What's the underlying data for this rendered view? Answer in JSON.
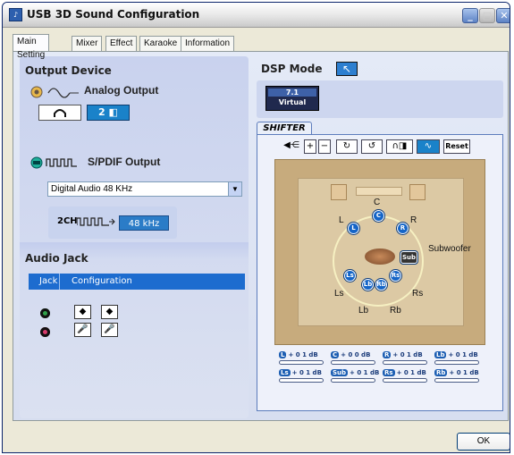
{
  "window": {
    "title": "USB 3D Sound Configuration",
    "app_icon": "speaker-app-icon"
  },
  "tabs": [
    "Main Setting",
    "Mixer",
    "Effect",
    "Karaoke",
    "Information"
  ],
  "output_device": {
    "heading": "Output Device",
    "analog_label": "Analog Output",
    "analog_modes": [
      "headphone",
      "2 speaker"
    ],
    "analog_selected": "2",
    "spdif_label": "S/PDIF Output",
    "spdif_select": "Digital Audio 48 KHz",
    "spdif_channel": "2CH",
    "spdif_rate": "48 kHz"
  },
  "audio_jack": {
    "heading": "Audio Jack",
    "col_jack": "Jack",
    "col_config": "Configuration",
    "jack_colors": [
      "#2fa048",
      "#d73a6b"
    ]
  },
  "dsp": {
    "heading": "DSP Mode",
    "virtual_title": "7.1",
    "virtual_sub": "Virtual",
    "shifter_tab": "SHIFTER",
    "reset_label": "Reset",
    "labels": {
      "C": "C",
      "L": "L",
      "R": "R",
      "Ls": "Ls",
      "Rs": "Rs",
      "Lb": "Lb",
      "Rb": "Rb",
      "Sub": "Subwoofer"
    },
    "meters": [
      {
        "ch": "L",
        "val": "+ 0 1 dB"
      },
      {
        "ch": "C",
        "val": "+ 0 0 dB"
      },
      {
        "ch": "R",
        "val": "+ 0 1 dB"
      },
      {
        "ch": "Lb",
        "val": "+ 0 1 dB"
      },
      {
        "ch": "Ls",
        "val": "+ 0 1 dB"
      },
      {
        "ch": "Sub",
        "val": "+ 0 1 dB"
      },
      {
        "ch": "Rs",
        "val": "+ 0 1 dB"
      },
      {
        "ch": "Rb",
        "val": "+ 0 1 dB"
      }
    ]
  },
  "ok_label": "OK"
}
